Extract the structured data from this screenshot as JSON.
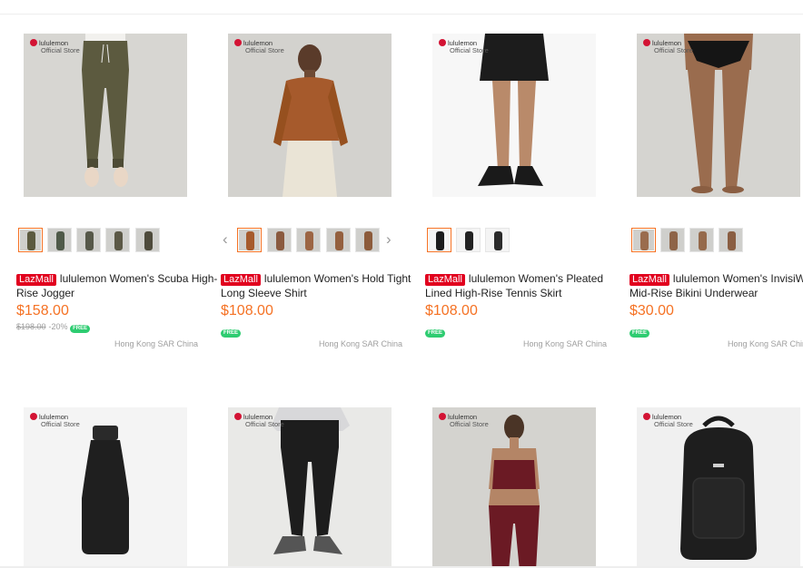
{
  "colors": {
    "accent": "#f57224",
    "lazmall": "#e1001e",
    "free": "#2ecc71"
  },
  "brand": {
    "name": "lululemon",
    "store": "Official Store"
  },
  "badge_label": "LazMall",
  "free_label": "FREE",
  "products": [
    {
      "title": "lululemon Women's Scuba High-Rise Jogger",
      "price": "$158.00",
      "original_price": "$198.00",
      "discount": "-20%",
      "location": "Hong Kong SAR China",
      "thumb_count": 5,
      "image": "olive-jogger"
    },
    {
      "title": "lululemon Women's Hold Tight Long Sleeve Shirt",
      "price": "$108.00",
      "location": "Hong Kong SAR China",
      "thumb_count": 5,
      "image": "brown-long-sleeve",
      "has_arrows": true
    },
    {
      "title": "lululemon Women's Pleated Lined High-Rise Tennis Skirt",
      "price": "$108.00",
      "location": "Hong Kong SAR China",
      "thumb_count": 3,
      "image": "black-tennis-skirt"
    },
    {
      "title": "lululemon Women's InvisiWear Mid-Rise Bikini Underwear",
      "price": "$30.00",
      "location": "Hong Kong SAR China",
      "thumb_count": 4,
      "image": "black-bikini-underwear"
    },
    {
      "image": "black-water-bottle"
    },
    {
      "image": "black-jogger"
    },
    {
      "image": "burgundy-sports-set"
    },
    {
      "image": "black-backpack"
    }
  ]
}
